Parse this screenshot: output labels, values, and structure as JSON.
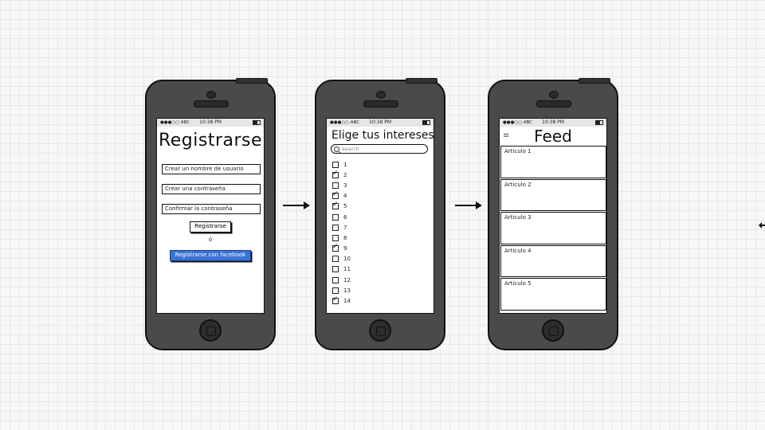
{
  "status": {
    "carrier": "●●●○○ ABC",
    "time": "10:38 PM"
  },
  "screen_register": {
    "title": "Registrarse",
    "fields": [
      "Crear un nombre de usuario",
      "Crear una contraseña",
      "Confirmar la contraseña"
    ],
    "submit_label": "Registrarse",
    "or_text": "ó",
    "facebook_label": "Registrarse con facebook"
  },
  "screen_interests": {
    "title": "Elige tus intereses",
    "search_placeholder": "search",
    "items": [
      {
        "label": "1",
        "checked": false
      },
      {
        "label": "2",
        "checked": true
      },
      {
        "label": "3",
        "checked": false
      },
      {
        "label": "4",
        "checked": true
      },
      {
        "label": "5",
        "checked": true
      },
      {
        "label": "6",
        "checked": false
      },
      {
        "label": "7",
        "checked": false
      },
      {
        "label": "8",
        "checked": false
      },
      {
        "label": "9",
        "checked": true
      },
      {
        "label": "10",
        "checked": false
      },
      {
        "label": "11",
        "checked": false
      },
      {
        "label": "12",
        "checked": false
      },
      {
        "label": "13",
        "checked": false
      },
      {
        "label": "14",
        "checked": true
      }
    ]
  },
  "screen_feed": {
    "title": "Feed",
    "articles": [
      "Articulo 1",
      "Articulo 2",
      "Articulo 3",
      "Articulo 4",
      "Articulo 5"
    ]
  },
  "colors": {
    "facebook": "#3b73d6",
    "phone_body": "#4a4a4a",
    "status_bar": "#e6e6e6"
  }
}
